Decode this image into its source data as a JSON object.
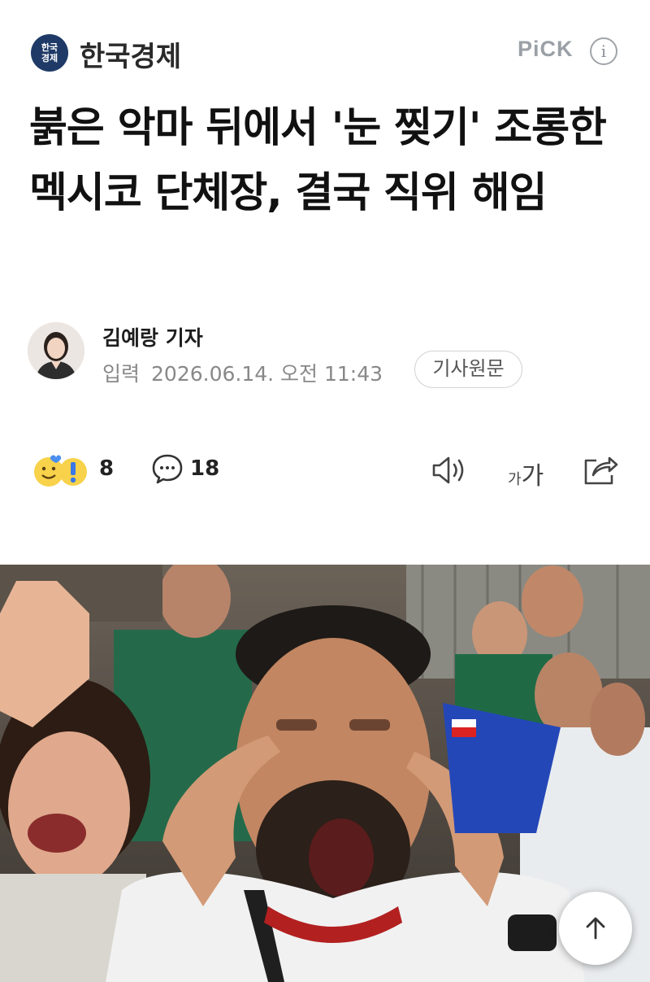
{
  "header": {
    "logo_text": "한국\n경제",
    "press_name": "한국경제",
    "pick_label": "PiCK",
    "info_icon": "info-icon"
  },
  "article": {
    "title": "붉은 악마 뒤에서 '눈 찢기' 조롱한 멕시코 단체장, 결국 직위 해임",
    "reporter": "김예랑 기자",
    "date_label": "입력",
    "date": "2026.06.14. 오전 11:43",
    "original_button": "기사원문"
  },
  "toolbar": {
    "reaction_icon": "emoji-reaction-icon",
    "reaction_count": "8",
    "comment_icon": "comment-bubble-icon",
    "comment_count": "18",
    "speaker_icon": "speaker-icon",
    "font_small": "가",
    "font_large": "가",
    "share_icon": "share-icon"
  },
  "photo": {
    "description_icon": "article-photo"
  },
  "scroll_top_icon": "arrow-up-icon"
}
